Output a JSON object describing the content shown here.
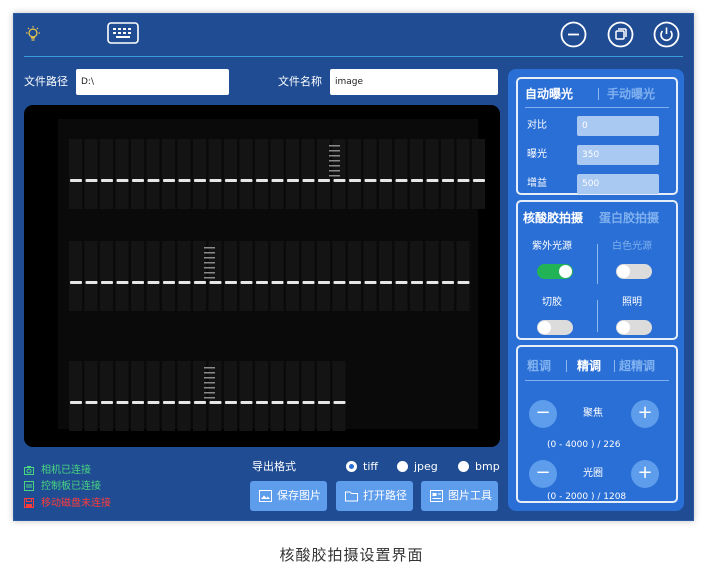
{
  "header": {
    "icons": [
      "bulb-icon",
      "keyboard-icon",
      "minimize-icon",
      "restore-icon",
      "power-icon"
    ]
  },
  "path_bar": {
    "path_label": "文件路径",
    "path_value": "D:\\",
    "name_label": "文件名称",
    "name_value": "image"
  },
  "status": {
    "items": [
      {
        "text": "相机已连接",
        "color": "#49d67f",
        "icon": "camera-icon"
      },
      {
        "text": "控制板已连接",
        "color": "#49d67f",
        "icon": "board-icon"
      },
      {
        "text": "移动磁盘未连接",
        "color": "#ff3b3b",
        "icon": "disk-icon"
      }
    ]
  },
  "export": {
    "label": "导出格式",
    "options": [
      {
        "text": "tiff",
        "selected": true
      },
      {
        "text": "jpeg",
        "selected": false
      },
      {
        "text": "bmp",
        "selected": false
      }
    ]
  },
  "actions": {
    "save_label": "保存图片",
    "open_label": "打开路径",
    "tools_label": "图片工具"
  },
  "exposure": {
    "tab_auto": "自动曝光",
    "tab_manual": "手动曝光",
    "contrast_label": "对比",
    "contrast_value": "0",
    "exposure_label": "曝光",
    "exposure_value": "350",
    "gain_label": "增益",
    "gain_value": "500"
  },
  "mode": {
    "tab_nucleic": "核酸胶拍摄",
    "tab_protein": "蛋白胶拍摄",
    "uv_label": "紫外光源",
    "uv_on": true,
    "white_label": "白色光源",
    "white_on": false,
    "cut_label": "切胶",
    "cut_on": false,
    "light_label": "照明",
    "light_on": false
  },
  "adjust": {
    "tab_coarse": "粗调",
    "tab_fine": "精调",
    "tab_superfine": "超精调",
    "minus_symbol": "−",
    "plus_symbol": "+",
    "focus_label": "聚焦",
    "focus_range": "(0 - 4000 )  /  226",
    "focus_value": 226,
    "aperture_label": "光圈",
    "aperture_range": "(0 - 2000 )  /  1208",
    "aperture_value": 1208
  },
  "caption": "核酸胶拍摄设置界面"
}
